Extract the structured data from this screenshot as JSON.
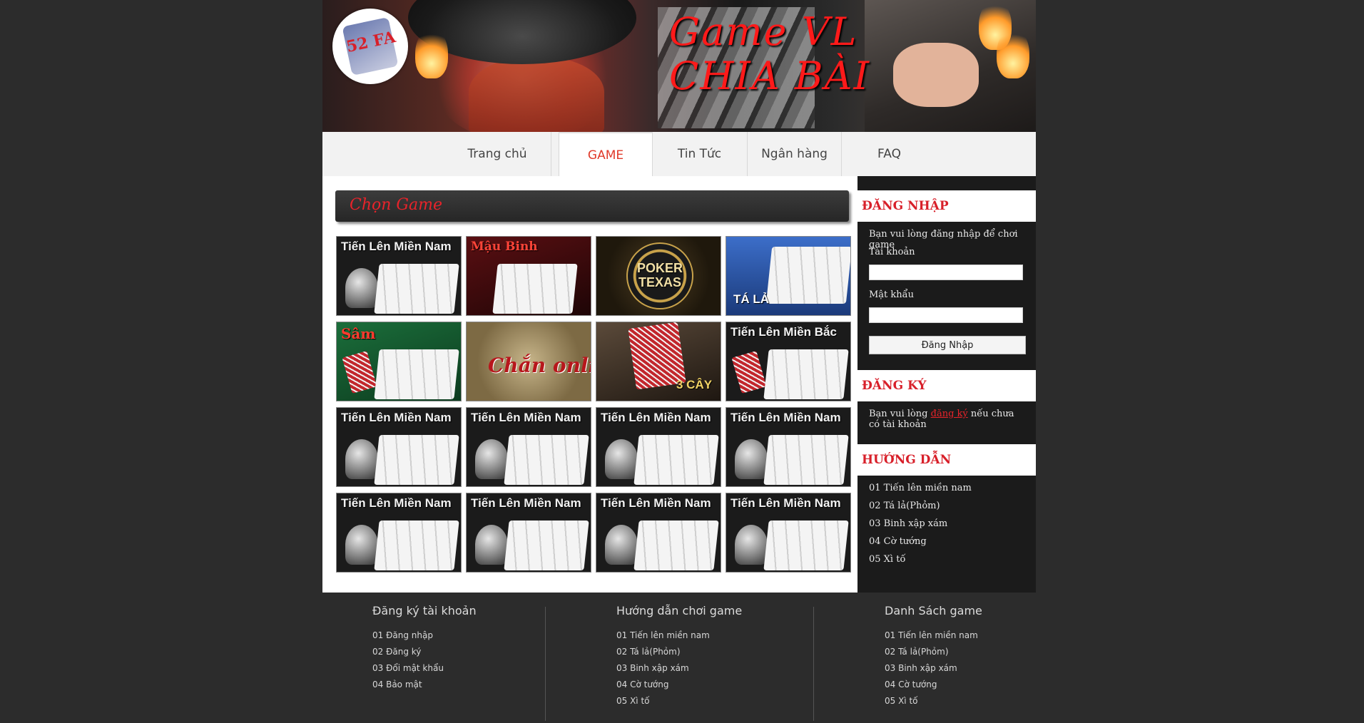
{
  "banner": {
    "logo_text": "52 FA",
    "title_line1": "Game VL",
    "title_line2": "CHIA BÀI"
  },
  "nav": {
    "items": [
      {
        "label": "Trang chủ"
      },
      {
        "label": "GAME"
      },
      {
        "label": "Tin Tức"
      },
      {
        "label": "Ngân hàng"
      },
      {
        "label": "FAQ"
      }
    ],
    "active": "GAME",
    "accent_color": "#e03a2a"
  },
  "main": {
    "section_title": "Chọn Game",
    "games": [
      {
        "label": "Tiến Lên Miền Nam",
        "icon": "club-cards-icon"
      },
      {
        "label": "Mậu Binh",
        "icon": "cards-icon"
      },
      {
        "label": "POKER TEXAS",
        "icon": "poker-chip-icon"
      },
      {
        "label": "TÁ LẢ",
        "icon": "cards-chips-icon"
      },
      {
        "label": "Sâm",
        "icon": "cards-icon"
      },
      {
        "label": "Chắn online",
        "icon": "plate-icon"
      },
      {
        "label": "3 CÂY",
        "icon": "hand-cards-icon"
      },
      {
        "label": "Tiến Lên Miền Bắc",
        "icon": "club-cards-icon"
      },
      {
        "label": "Tiến Lên Miền Nam",
        "icon": "club-cards-icon"
      },
      {
        "label": "Tiến Lên Miền Nam",
        "icon": "club-cards-icon"
      },
      {
        "label": "Tiến Lên Miền Nam",
        "icon": "club-cards-icon"
      },
      {
        "label": "Tiến Lên Miền Nam",
        "icon": "club-cards-icon"
      },
      {
        "label": "Tiến Lên Miền Nam",
        "icon": "club-cards-icon"
      },
      {
        "label": "Tiến Lên Miền Nam",
        "icon": "club-cards-icon"
      },
      {
        "label": "Tiến Lên Miền Nam",
        "icon": "club-cards-icon"
      },
      {
        "label": "Tiến Lên Miền Nam",
        "icon": "club-cards-icon"
      }
    ]
  },
  "sidebar": {
    "login": {
      "heading": "ĐĂNG NHẬP",
      "intro": "Bạn vui lòng đăng nhập để chơi game",
      "username_label": "Tài khoản",
      "username_value": "",
      "password_label": "Mật khẩu",
      "password_value": "",
      "submit_label": "Đăng Nhập"
    },
    "register": {
      "heading": "ĐĂNG KÝ",
      "text_before": "Bạn vui lòng ",
      "link_label": "đăng ký",
      "text_after": " nếu chưa có tài khoản"
    },
    "guide": {
      "heading": "HƯỚNG DẪN",
      "items": [
        "01 Tiến lên miền nam",
        "02 Tá lả(Phỏm)",
        "03 Binh xập xám",
        "04 Cờ tướng",
        "05 Xì tố"
      ]
    }
  },
  "footer": {
    "col1": {
      "heading": "Đăng ký tài khoản",
      "items": [
        "01 Đăng nhập",
        "02 Đăng ký",
        "03 Đổi mật khẩu",
        "04 Bảo mật"
      ]
    },
    "col2": {
      "heading": "Hướng dẫn chơi game",
      "items": [
        "01 Tiến lên miền nam",
        "02 Tá lả(Phỏm)",
        "03 Binh xập xám",
        "04 Cờ tướng",
        "05 Xì tố"
      ]
    },
    "col3": {
      "heading": "Danh Sách game",
      "items": [
        "01 Tiến lên miền nam",
        "02 Tá lả(Phỏm)",
        "03 Binh xập xám",
        "04 Cờ tướng",
        "05 Xì tố"
      ]
    }
  }
}
